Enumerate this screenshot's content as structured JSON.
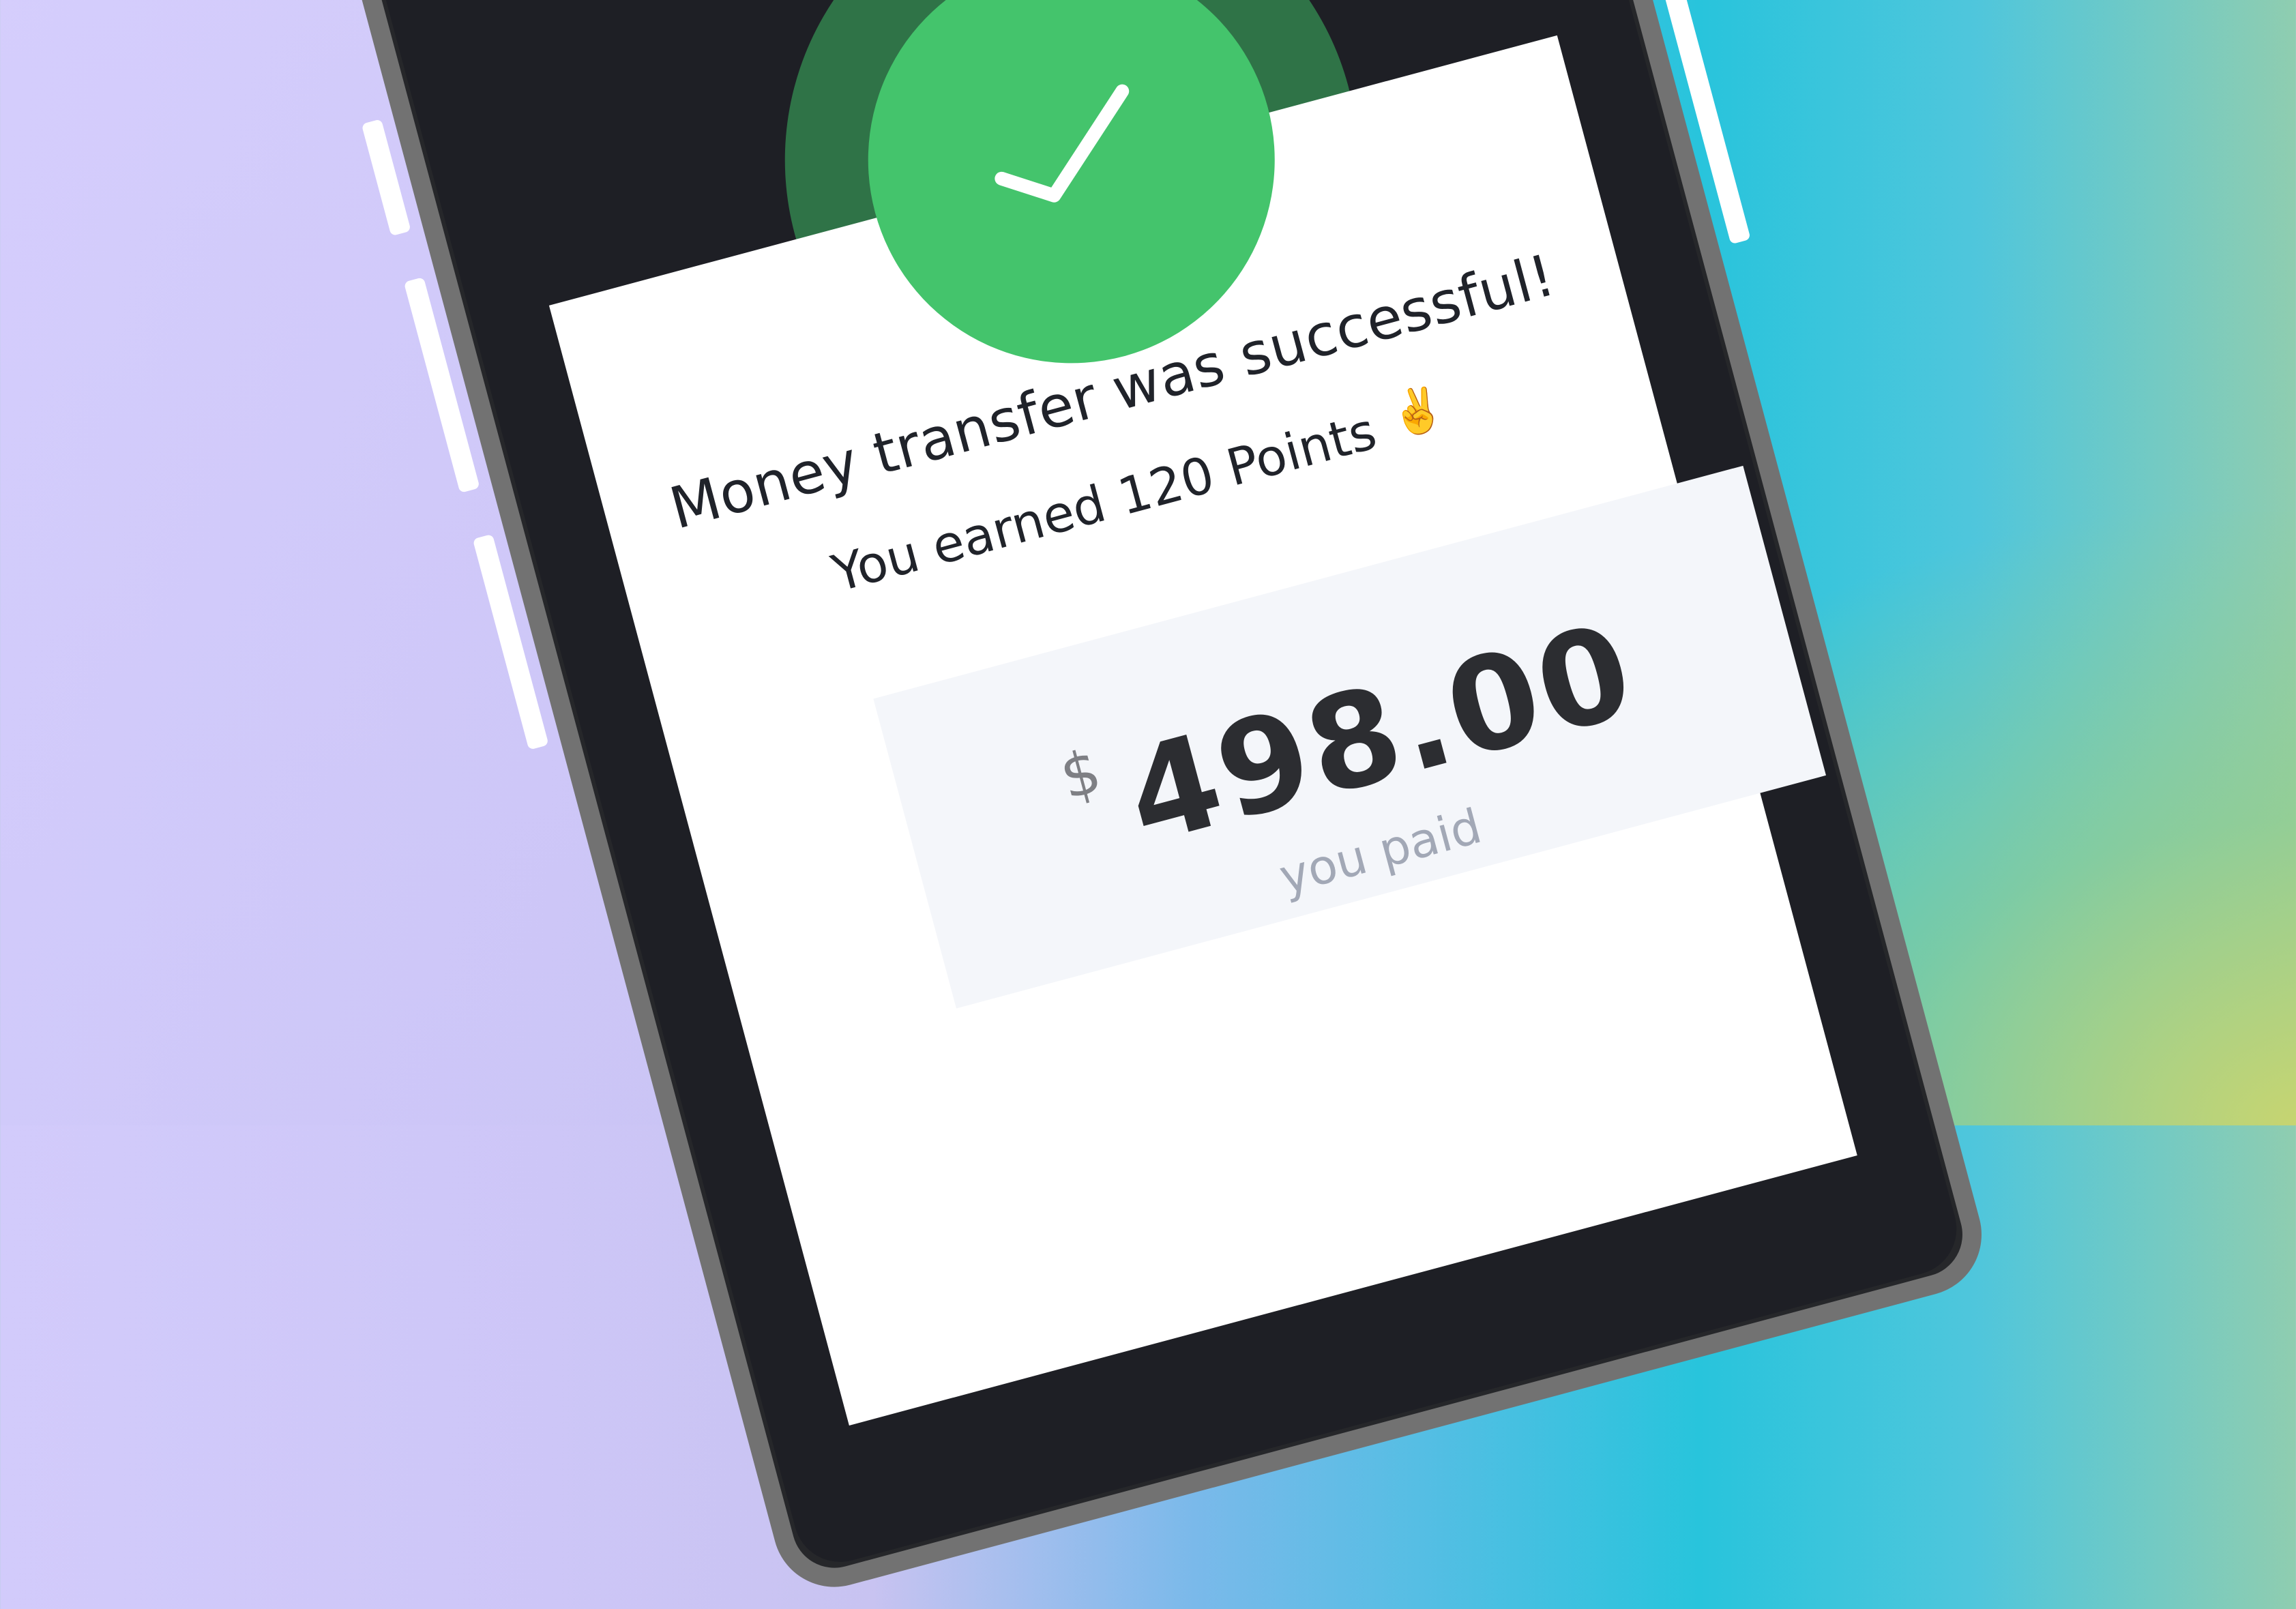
{
  "status": {
    "icon": "checkmark-icon",
    "title": "Money transfer was successful!",
    "points_text": "You earned 120 Points",
    "points_emoji": "✌️"
  },
  "payment": {
    "currency": "$",
    "amount": "498.00",
    "label": "you paid"
  },
  "colors": {
    "success_green": "#44c46c",
    "success_dark_green": "#2f7347",
    "phone_frame": "#727272",
    "screen_dark": "#1f2024",
    "card_bg": "#ffffff",
    "amount_box_bg": "#f4f6fa",
    "text_primary": "#20232a",
    "text_muted": "#a2a8b6"
  }
}
